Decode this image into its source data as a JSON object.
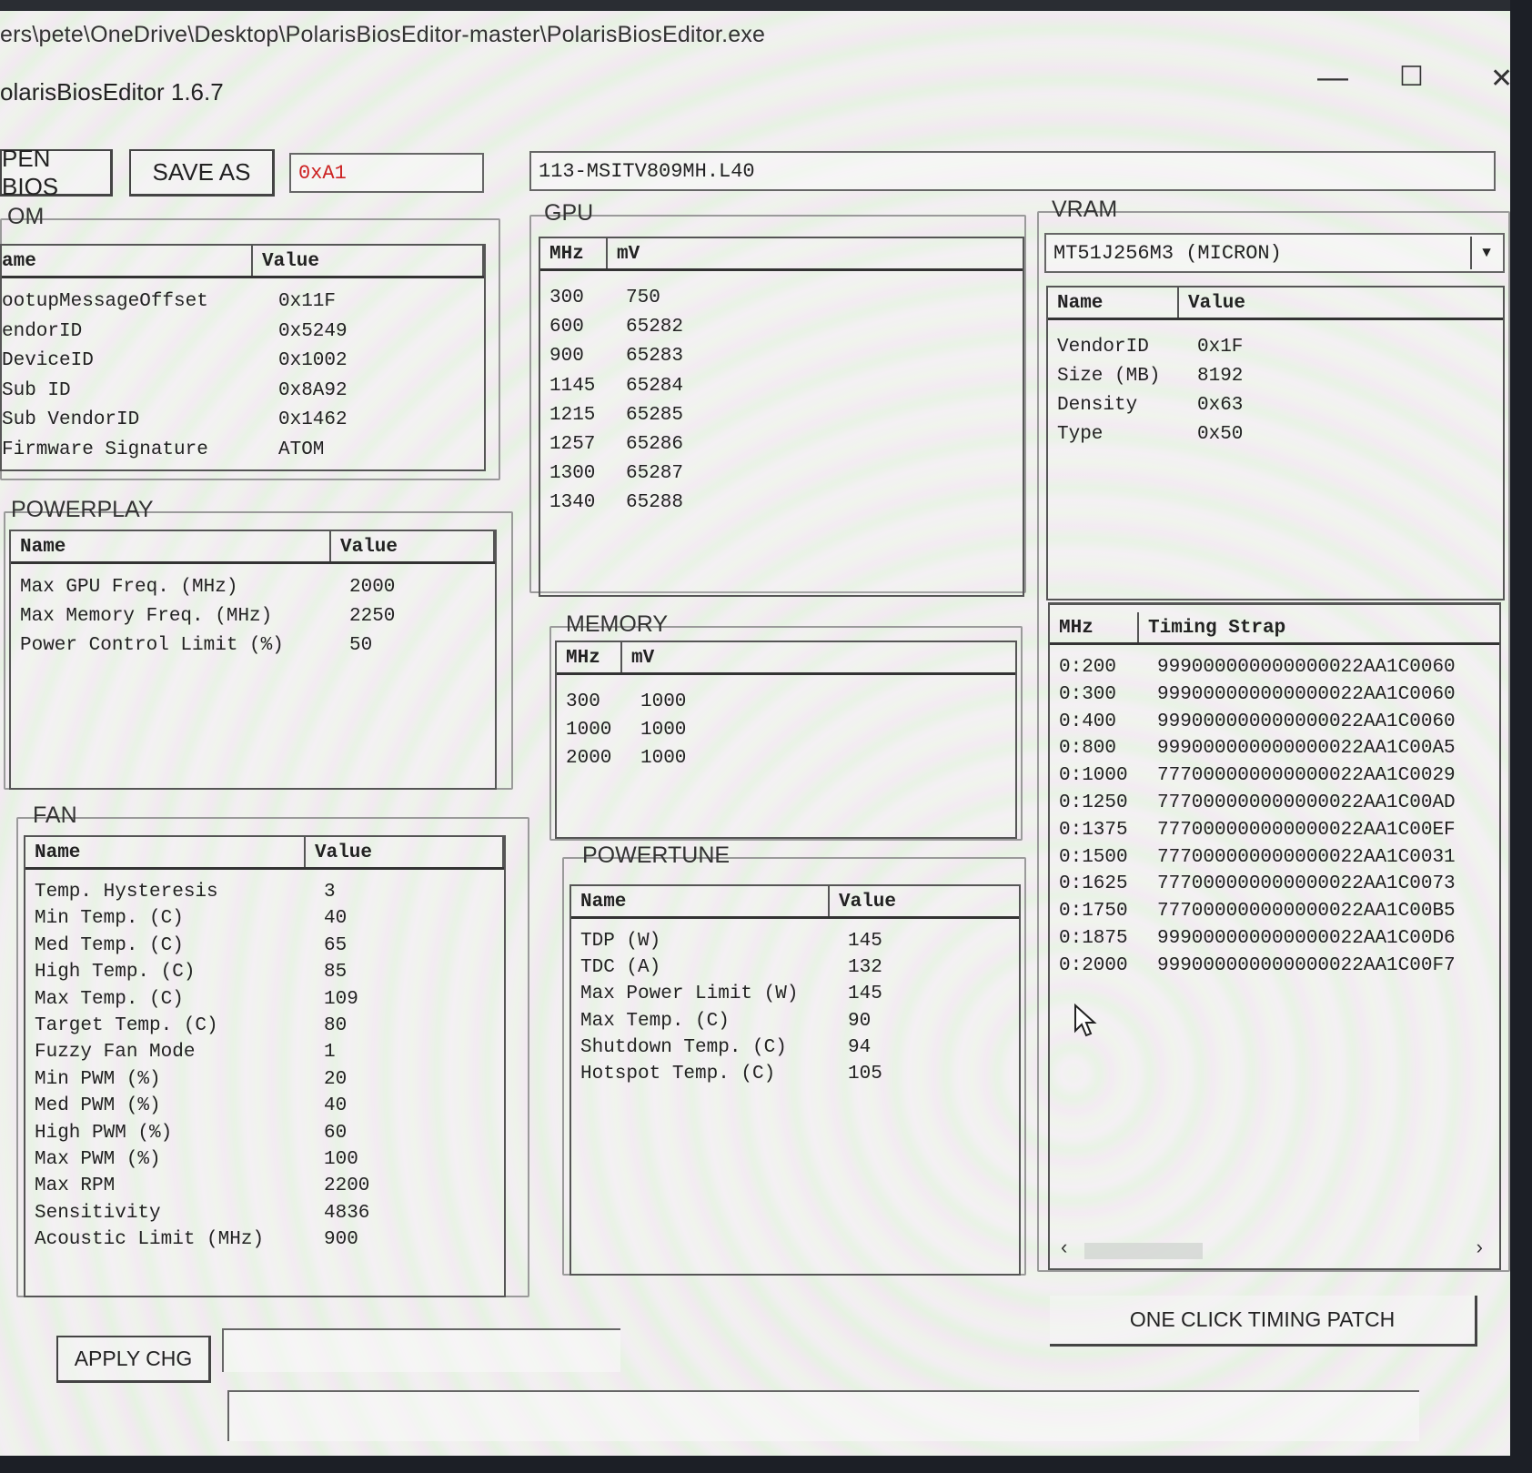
{
  "window": {
    "path": "ers\\pete\\OneDrive\\Desktop\\PolarisBiosEditor-master\\PolarisBiosEditor.exe",
    "title": "olarisBiosEditor 1.6.7",
    "minimize": "—",
    "maximize": "☐",
    "close": "✕"
  },
  "toolbar": {
    "open_label": "PEN BIOS",
    "save_label": "SAVE AS",
    "checksum": "0xA1",
    "checksum_color": "#cc2222",
    "bios_name": "113-MSITV809MH.L40"
  },
  "rom": {
    "title": "OM",
    "headers": [
      "ame",
      "Value"
    ],
    "rows": [
      [
        "ootupMessageOffset",
        "0x11F"
      ],
      [
        "endorID",
        "0x5249"
      ],
      [
        "DeviceID",
        "0x1002"
      ],
      [
        "Sub ID",
        "0x8A92"
      ],
      [
        "Sub VendorID",
        "0x1462"
      ],
      [
        "Firmware Signature",
        "ATOM"
      ]
    ]
  },
  "powerplay": {
    "title": "POWERPLAY",
    "headers": [
      "Name",
      "Value"
    ],
    "rows": [
      [
        "Max GPU Freq. (MHz)",
        "2000"
      ],
      [
        "Max Memory Freq. (MHz)",
        "2250"
      ],
      [
        "Power Control Limit (%)",
        "50"
      ]
    ]
  },
  "fan": {
    "title": "FAN",
    "headers": [
      "Name",
      "Value"
    ],
    "rows": [
      [
        "Temp. Hysteresis",
        "3"
      ],
      [
        "Min Temp. (C)",
        "40"
      ],
      [
        "Med Temp. (C)",
        "65"
      ],
      [
        "High Temp. (C)",
        "85"
      ],
      [
        "Max Temp. (C)",
        "109"
      ],
      [
        "Target Temp. (C)",
        "80"
      ],
      [
        "Fuzzy Fan Mode",
        "1"
      ],
      [
        "Min PWM (%)",
        "20"
      ],
      [
        "Med PWM (%)",
        "40"
      ],
      [
        "High PWM (%)",
        "60"
      ],
      [
        "Max PWM (%)",
        "100"
      ],
      [
        "Max RPM",
        "2200"
      ],
      [
        "Sensitivity",
        "4836"
      ],
      [
        "Acoustic Limit (MHz)",
        "900"
      ]
    ]
  },
  "gpu": {
    "title": "GPU",
    "headers": [
      "MHz",
      "mV"
    ],
    "rows": [
      [
        "300",
        "750"
      ],
      [
        "600",
        "65282"
      ],
      [
        "900",
        "65283"
      ],
      [
        "1145",
        "65284"
      ],
      [
        "1215",
        "65285"
      ],
      [
        "1257",
        "65286"
      ],
      [
        "1300",
        "65287"
      ],
      [
        "1340",
        "65288"
      ]
    ]
  },
  "memory": {
    "title": "MEMORY",
    "headers": [
      "MHz",
      "mV"
    ],
    "rows": [
      [
        "300",
        "1000"
      ],
      [
        "1000",
        "1000"
      ],
      [
        "2000",
        "1000"
      ]
    ]
  },
  "powertune": {
    "title": "POWERTUNE",
    "headers": [
      "Name",
      "Value"
    ],
    "rows": [
      [
        "TDP (W)",
        "145"
      ],
      [
        "TDC (A)",
        "132"
      ],
      [
        "Max Power Limit (W)",
        "145"
      ],
      [
        "Max Temp. (C)",
        "90"
      ],
      [
        "Shutdown Temp. (C)",
        "94"
      ],
      [
        "Hotspot Temp. (C)",
        "105"
      ]
    ]
  },
  "vram": {
    "title": "VRAM",
    "selected": "MT51J256M3 (MICRON)",
    "dropdown_icon": "▼",
    "headers": [
      "Name",
      "Value"
    ],
    "rows": [
      [
        "VendorID",
        "0x1F"
      ],
      [
        "Size (MB)",
        "8192"
      ],
      [
        "Density",
        "0x63"
      ],
      [
        "Type",
        "0x50"
      ]
    ]
  },
  "timings": {
    "headers": [
      "MHz",
      "Timing Strap"
    ],
    "rows": [
      [
        "0:200",
        "999000000000000022AA1C0060"
      ],
      [
        "0:300",
        "999000000000000022AA1C0060"
      ],
      [
        "0:400",
        "999000000000000022AA1C0060"
      ],
      [
        "0:800",
        "999000000000000022AA1C00A5"
      ],
      [
        "0:1000",
        "777000000000000022AA1C0029"
      ],
      [
        "0:1250",
        "777000000000000022AA1C00AD"
      ],
      [
        "0:1375",
        "777000000000000022AA1C00EF"
      ],
      [
        "0:1500",
        "777000000000000022AA1C0031"
      ],
      [
        "0:1625",
        "777000000000000022AA1C0073"
      ],
      [
        "0:1750",
        "777000000000000022AA1C00B5"
      ],
      [
        "0:1875",
        "999000000000000022AA1C00D6"
      ],
      [
        "0:2000",
        "999000000000000022AA1C00F7"
      ]
    ],
    "scroll_left": "‹",
    "scroll_right": "›"
  },
  "actions": {
    "apply_label": "APPLY CHG",
    "timing_patch_label": "ONE CLICK TIMING PATCH",
    "apply_field_value": "",
    "status_value": ""
  }
}
